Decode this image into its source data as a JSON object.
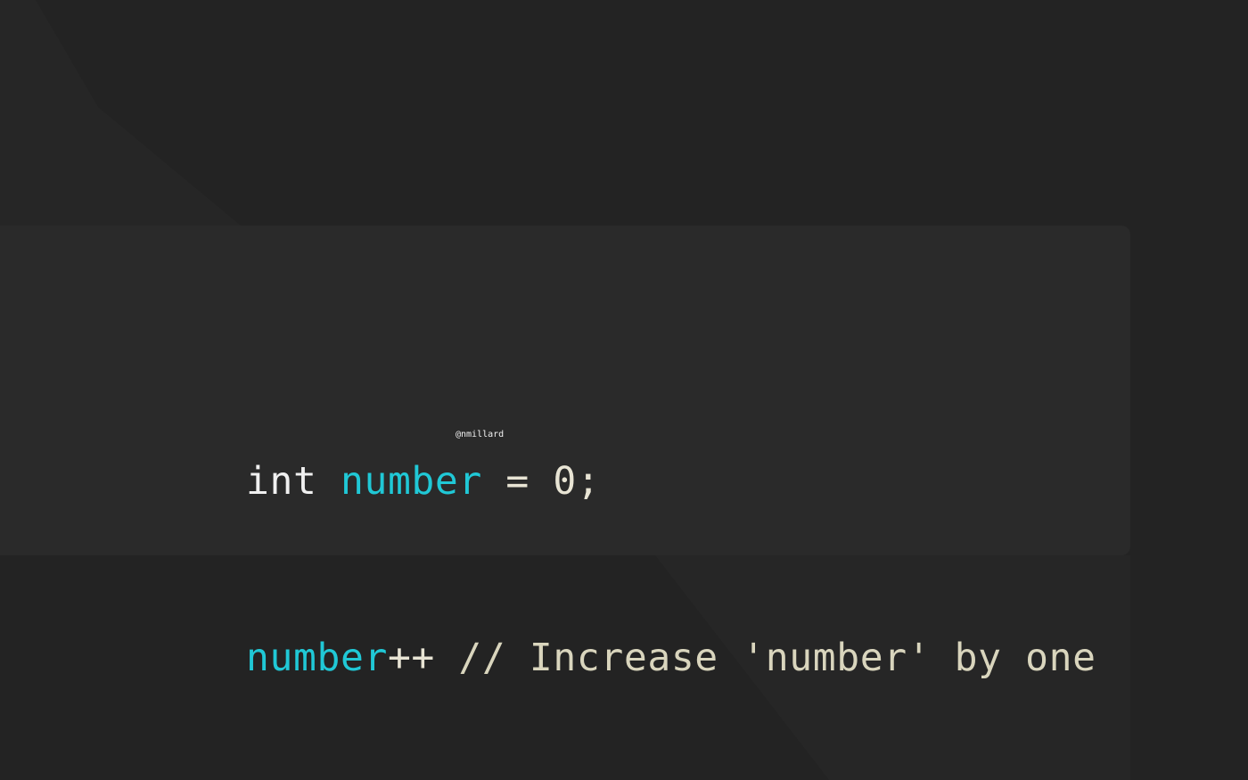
{
  "code": {
    "line1": {
      "keyword": "int",
      "identifier": "number",
      "operator": "=",
      "number": "0",
      "terminator": ";"
    },
    "line2": {
      "identifier": "number",
      "operator": "++",
      "comment": "// Increase 'number' by one"
    }
  },
  "watermark": "@nmillard",
  "colors": {
    "background": "#232323",
    "panel": "#2a2a2a",
    "identifier": "#20c8d6",
    "keyword": "#f0f0f0",
    "comment": "#d9d5bd"
  }
}
